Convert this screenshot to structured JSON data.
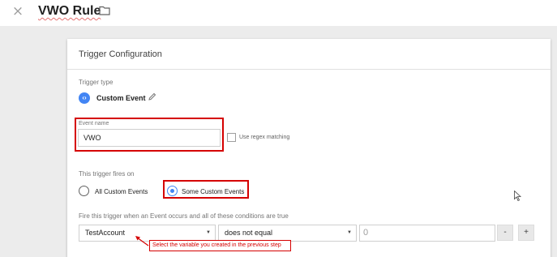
{
  "header": {
    "close_glyph": "×",
    "title": "VWO Rule",
    "folder_icon": "folder-icon"
  },
  "panel": {
    "title": "Trigger Configuration",
    "trigger_type_label": "Trigger type",
    "trigger_type": "Custom Event",
    "trigger_type_glyph": "‹›",
    "event_name_label": "Event name",
    "event_name_value": "VWO",
    "regex_label": "Use regex matching",
    "fires_on_label": "This trigger fires on",
    "option_all": "All Custom Events",
    "option_some": "Some Custom Events",
    "condition_label": "Fire this trigger when an Event occurs and all of these conditions are true",
    "condition": {
      "variable": "TestAccount",
      "operator": "does not equal",
      "value": "0"
    },
    "minus_label": "-",
    "plus_label": "+",
    "annotation": "Select the variable you created in the previous step"
  },
  "colors": {
    "accent": "#4285f4",
    "highlight": "#d50000"
  }
}
